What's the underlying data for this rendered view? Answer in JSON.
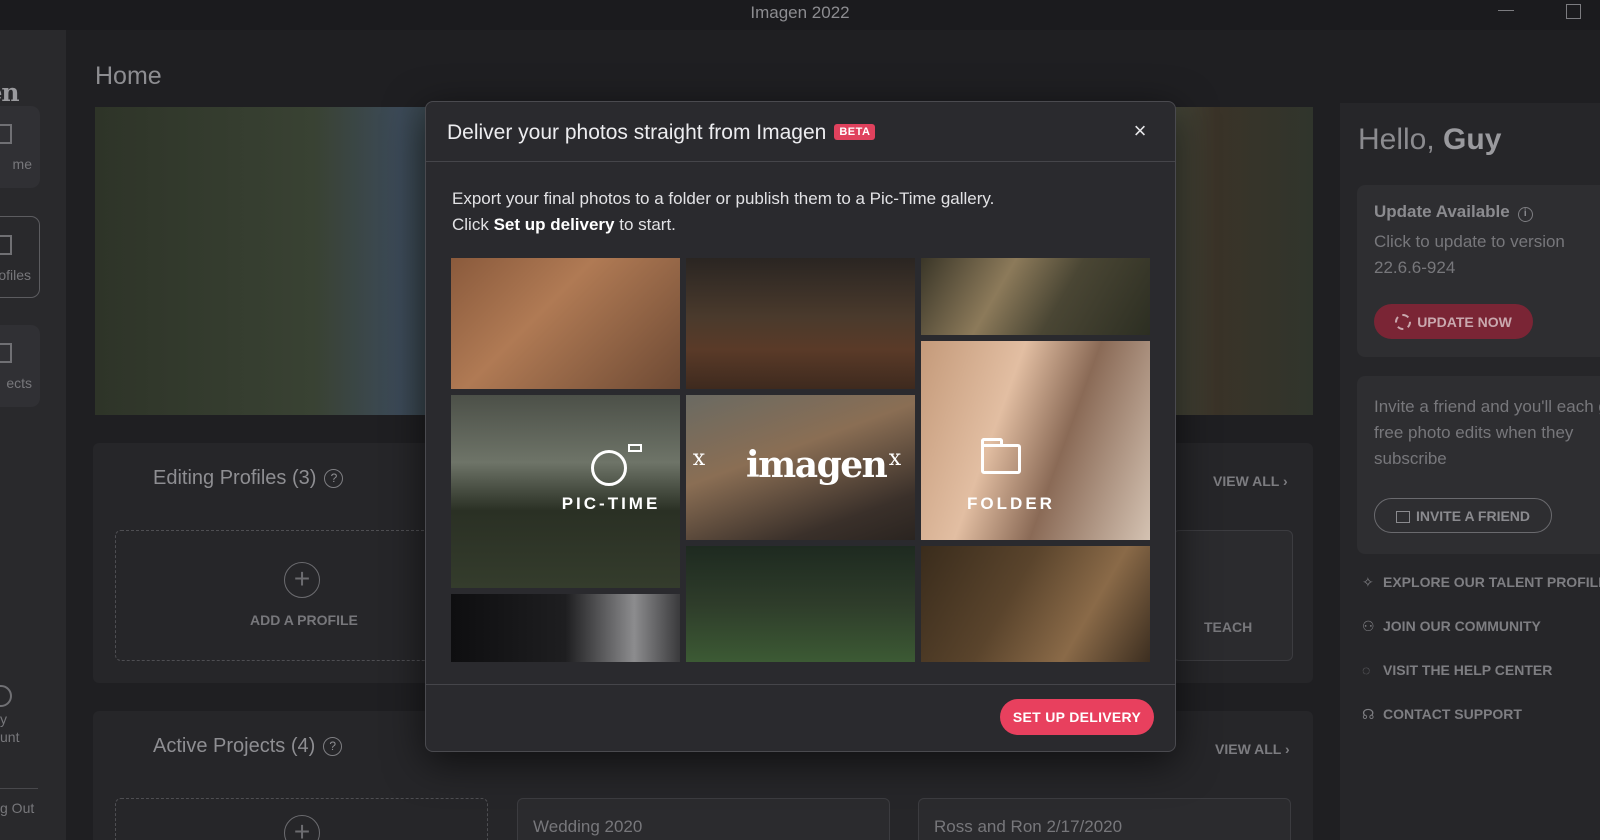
{
  "window": {
    "title": "Imagen 2022"
  },
  "nav": {
    "brand": "gen",
    "items": [
      {
        "label": "me"
      },
      {
        "label": "ofiles"
      },
      {
        "label": "ects"
      }
    ],
    "account": {
      "line1": "y",
      "line2": "unt"
    },
    "logout": "g Out"
  },
  "main": {
    "title": "Home",
    "editing_profiles": {
      "title": "Editing Profiles (3)",
      "help": "?",
      "view_all": "VIEW ALL ›",
      "add_label": "ADD A PROFILE",
      "plus": "+",
      "card_label": "TEACH"
    },
    "active_projects": {
      "title": "Active Projects (4)",
      "help": "?",
      "view_all": "VIEW ALL ›",
      "plus": "+",
      "projects": [
        "Wedding 2020",
        "Ross and Ron 2/17/2020"
      ]
    }
  },
  "right_panel": {
    "greeting": "Hello,",
    "name": "Guy",
    "update": {
      "title": "Update Available",
      "info": "i",
      "text": "Click to update to version 22.6.6-924",
      "button": "UPDATE NOW"
    },
    "invite": {
      "text": "Invite a friend and you'll each get free photo edits when they subscribe",
      "button": "INVITE A FRIEND"
    },
    "links": [
      {
        "label": "EXPLORE OUR TALENT PROFILES",
        "icon": "sparkle-icon",
        "glyph": "✧"
      },
      {
        "label": "JOIN OUR COMMUNITY",
        "icon": "people-icon",
        "glyph": "⚇"
      },
      {
        "label": "VISIT THE HELP CENTER",
        "icon": "lightbulb-icon",
        "glyph": "◌"
      },
      {
        "label": "CONTACT SUPPORT",
        "icon": "headset-icon",
        "glyph": "☊"
      }
    ]
  },
  "modal": {
    "title": "Deliver your photos straight from Imagen",
    "badge": "BETA",
    "close": "×",
    "desc_line1": "Export your final photos to a folder or publish them to a Pic-Time gallery.",
    "desc_prefix": "Click ",
    "desc_bold": "Set up delivery",
    "desc_suffix": " to start.",
    "collage": {
      "pictime_label": "PIC-TIME",
      "x1": "x",
      "imagen_logo": "imagen",
      "x2": "x",
      "folder_label": "FOLDER"
    },
    "primary_button": "SET UP DELIVERY"
  },
  "colors": {
    "accent": "#e8405e",
    "background": "#1f1f22",
    "modal_bg": "#2a2a2e"
  }
}
